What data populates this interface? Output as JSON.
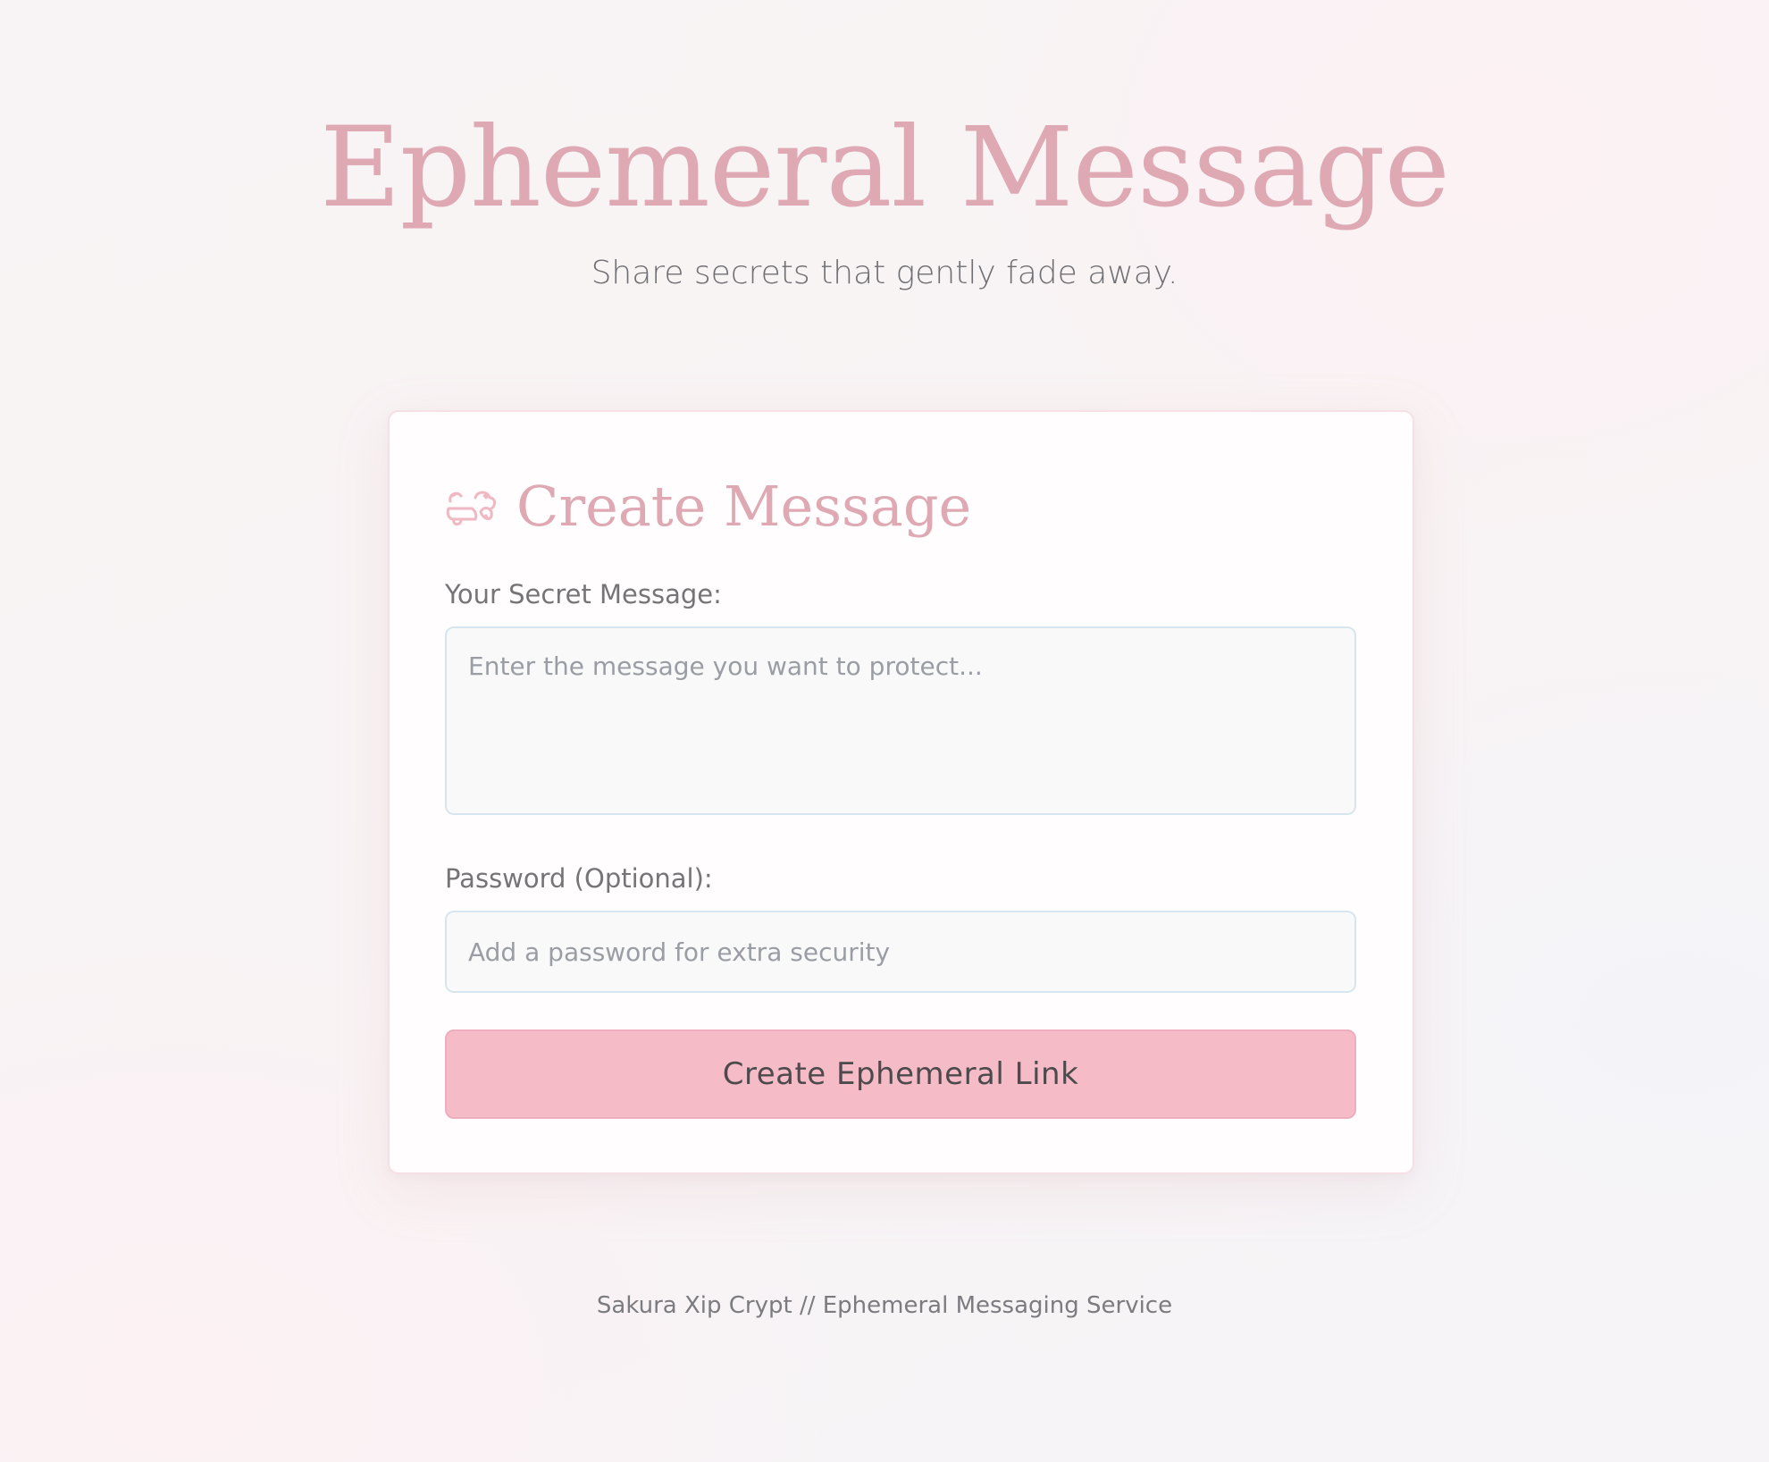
{
  "header": {
    "title": "Ephemeral Message",
    "subtitle": "Share secrets that gently fade away."
  },
  "card": {
    "icon": "cherry-blossom-cloud-icon",
    "title": "Create Message",
    "message_label": "Your Secret Message:",
    "message_placeholder": "Enter the message you want to protect...",
    "message_value": "",
    "password_label": "Password (Optional):",
    "password_placeholder": "Add a password for extra security",
    "password_value": "",
    "submit_label": "Create Ephemeral Link"
  },
  "footer": {
    "text": "Sakura Xip Crypt // Ephemeral Messaging Service"
  },
  "colors": {
    "accent_pink": "#dfa9b4",
    "button_pink": "#f5bbc7",
    "input_border": "#d7e6ee",
    "text_gray": "#757578"
  }
}
